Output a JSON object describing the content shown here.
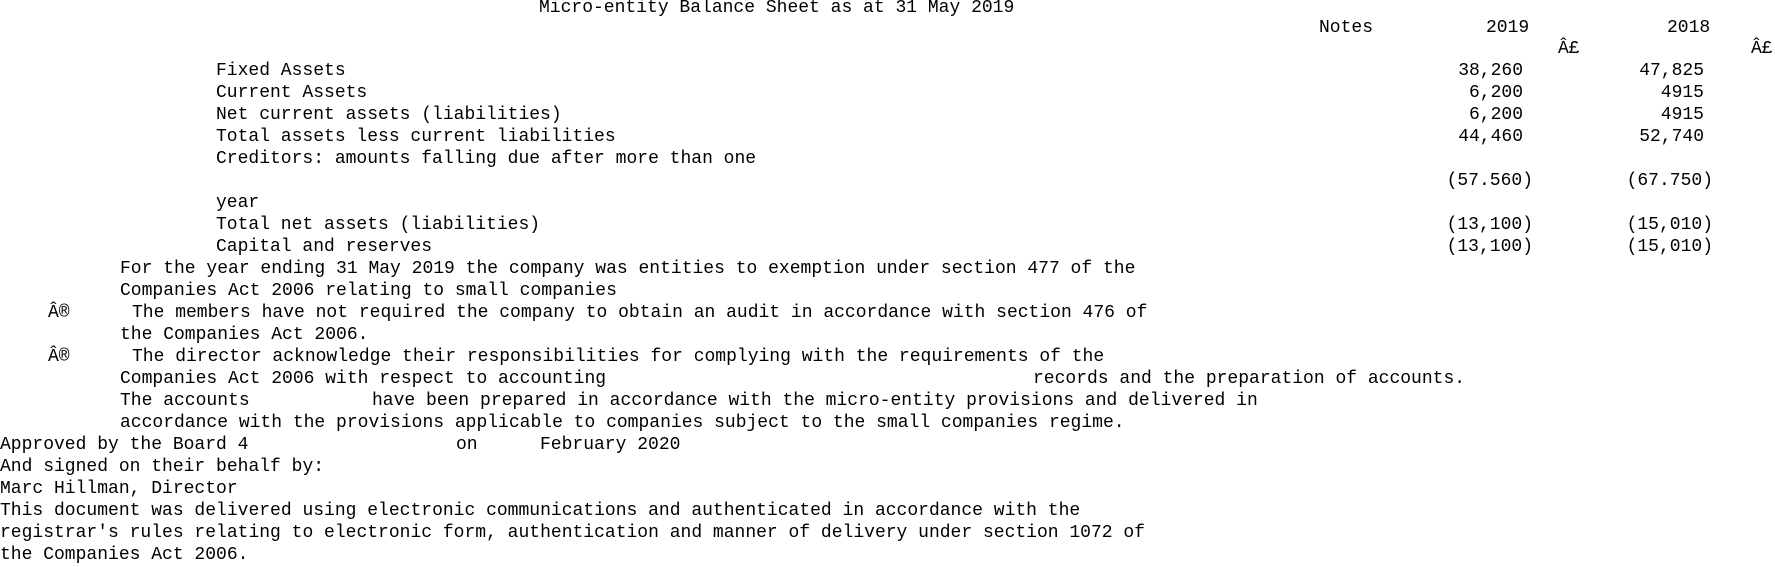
{
  "title": "Micro-entity Balance Sheet as at 31 May 2019",
  "header": {
    "notes": "Notes",
    "year_current": "2019",
    "year_prior": "2018",
    "currency_current": "Â£",
    "currency_prior": "Â£"
  },
  "rows": [
    {
      "label": "Fixed Assets",
      "current": "38,260",
      "prior": "47,825"
    },
    {
      "label": "Current Assets",
      "current": "6,200",
      "prior": "4915"
    },
    {
      "label": "Net current assets (liabilities)",
      "current": "6,200",
      "prior": "4915"
    },
    {
      "label": "Total assets less current liabilities",
      "current": "44,460",
      "prior": "52,740"
    },
    {
      "label": "Creditors: amounts falling due after more than one",
      "label_cont": "year",
      "current": "(57.560)",
      "prior": "(67.750)"
    },
    {
      "label": "Total net assets (liabilities)",
      "current": "(13,100)",
      "prior": "(15,010)"
    },
    {
      "label": "Capital and reserves",
      "current": "(13,100)",
      "prior": "(15,010)"
    }
  ],
  "statements": {
    "exemption_1": "For the year ending 31 May 2019 the company was entities to exemption under section 477 of the",
    "exemption_2": "Companies Act 2006 relating to small companies",
    "bullet": "Â®",
    "audit_1": "The members have not required the company to obtain an audit in accordance with section 476 of",
    "audit_2": "the Companies Act 2006.",
    "director_1": "The director acknowledge their responsibilities for complying with the requirements of the",
    "director_2a": "Companies Act 2006 with respect to accounting",
    "director_2b": "records and the preparation of accounts.",
    "accounts_1a": "The accounts",
    "accounts_1b": "have been prepared in accordance with the micro-entity provisions and delivered in",
    "accounts_2": "accordance with the provisions applicable to companies subject to the small companies regime."
  },
  "approval": {
    "approved_a": "Approved by the Board 4",
    "approved_b": "on",
    "approved_c": "February 2020",
    "signed": "And signed on their behalf by:",
    "signatory": "Marc Hillman, Director"
  },
  "footer": {
    "line_1": "This document was delivered using electronic communications and authenticated in accordance with the",
    "line_2": "registrar's rules relating to electronic form, authentication and manner of delivery under section 1072 of",
    "line_3": "the Companies Act 2006."
  }
}
